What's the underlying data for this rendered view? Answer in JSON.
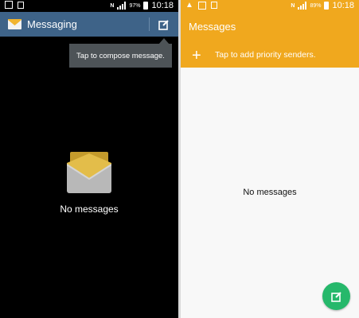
{
  "left_screen": {
    "status_bar": {
      "battery": "97%",
      "time": "10:18"
    },
    "app_bar": {
      "title": "Messaging"
    },
    "tooltip": {
      "text": "Tap to compose message."
    },
    "empty_state": {
      "text": "No messages"
    },
    "colors": {
      "app_bar": "#3e6388",
      "background": "#000000",
      "tooltip": "#4d5357"
    }
  },
  "right_screen": {
    "status_bar": {
      "battery": "89%",
      "time": "10:18"
    },
    "header": {
      "title": "Messages",
      "priority_text": "Tap to add priority senders."
    },
    "empty_state": {
      "text": "No messages"
    },
    "colors": {
      "header": "#f0a81e",
      "background": "#f8f8f8",
      "fab": "#26b86b"
    }
  }
}
